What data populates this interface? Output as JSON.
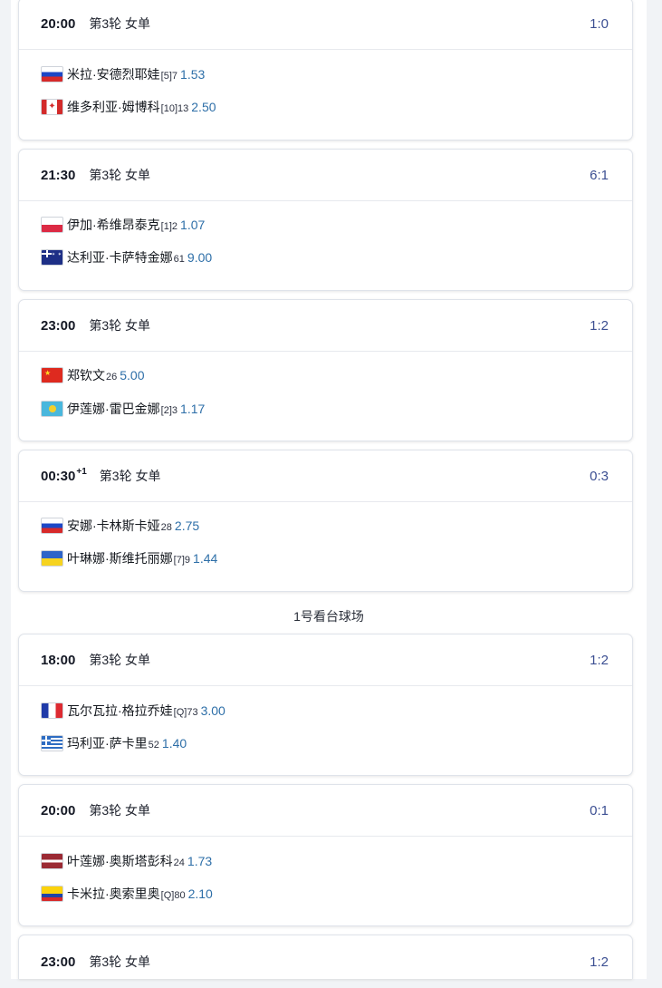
{
  "section_label": "1号看台球场",
  "matches": [
    {
      "time": "20:00",
      "time_sup": "",
      "round": "第3轮 女单",
      "score": "1:0",
      "players": [
        {
          "flag": "russia-flag",
          "name": "米拉·安德烈耶娃",
          "rank": "[5]7",
          "odds": "1.53"
        },
        {
          "flag": "canada-flag",
          "name": "维多利亚·姆博科",
          "rank": "[10]13",
          "odds": "2.50"
        }
      ]
    },
    {
      "time": "21:30",
      "time_sup": "",
      "round": "第3轮 女单",
      "score": "6:1",
      "players": [
        {
          "flag": "poland-flag",
          "name": "伊加·希维昂泰克",
          "rank": "[1]2",
          "odds": "1.07"
        },
        {
          "flag": "australia-flag",
          "name": "达利亚·卡萨特金娜",
          "rank": "61",
          "odds": "9.00"
        }
      ]
    },
    {
      "time": "23:00",
      "time_sup": "",
      "round": "第3轮 女单",
      "score": "1:2",
      "players": [
        {
          "flag": "china-flag",
          "name": "郑钦文",
          "rank": "26",
          "odds": "5.00"
        },
        {
          "flag": "kazakhstan-flag",
          "name": "伊莲娜·雷巴金娜",
          "rank": "[2]3",
          "odds": "1.17"
        }
      ]
    },
    {
      "time": "00:30",
      "time_sup": "+1",
      "round": "第3轮 女单",
      "score": "0:3",
      "players": [
        {
          "flag": "russia-flag",
          "name": "安娜·卡林斯卡娅",
          "rank": "28",
          "odds": "2.75"
        },
        {
          "flag": "ukraine-flag",
          "name": "叶琳娜·斯维托丽娜",
          "rank": "[7]9",
          "odds": "1.44"
        }
      ]
    },
    {
      "time": "18:00",
      "time_sup": "",
      "round": "第3轮 女单",
      "score": "1:2",
      "players": [
        {
          "flag": "france-flag",
          "name": "瓦尔瓦拉·格拉乔娃",
          "rank": "[Q]73",
          "odds": "3.00"
        },
        {
          "flag": "greece-flag",
          "name": "玛利亚·萨卡里",
          "rank": "52",
          "odds": "1.40"
        }
      ]
    },
    {
      "time": "20:00",
      "time_sup": "",
      "round": "第3轮 女单",
      "score": "0:1",
      "players": [
        {
          "flag": "latvia-flag",
          "name": "叶莲娜·奥斯塔彭科",
          "rank": "24",
          "odds": "1.73"
        },
        {
          "flag": "colombia-flag",
          "name": "卡米拉·奥索里奥",
          "rank": "[Q]80",
          "odds": "2.10"
        }
      ]
    },
    {
      "time": "23:00",
      "time_sup": "",
      "round": "第3轮 女单",
      "score": "1:2",
      "players": []
    }
  ]
}
